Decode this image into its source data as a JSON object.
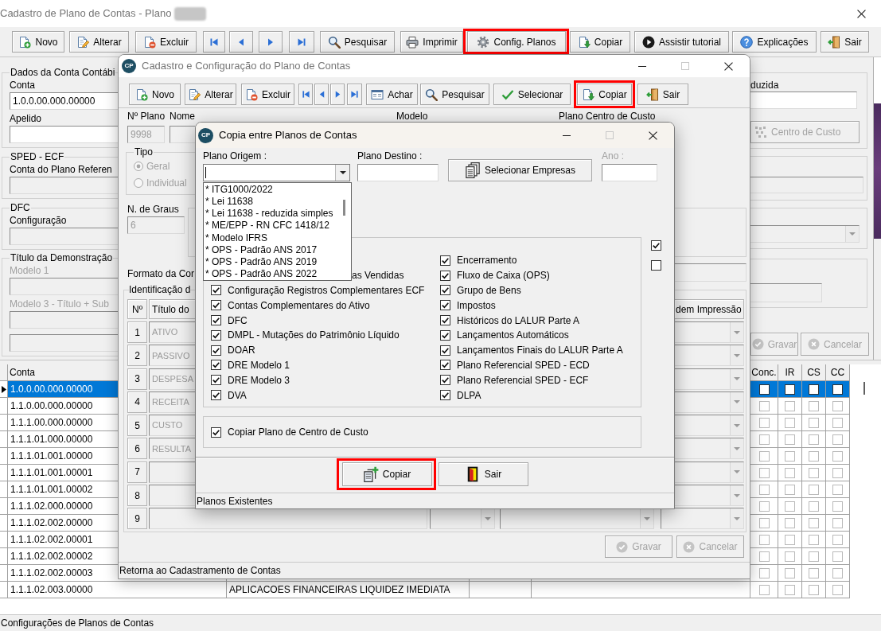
{
  "main_window": {
    "title": "Cadastro de Plano de Contas - Plano",
    "active": false,
    "controls": [
      {
        "kind": "close",
        "disabled": false
      }
    ],
    "toolbar": [
      {
        "kind": "new",
        "label": "Novo",
        "highlighted": false
      },
      {
        "kind": "edit",
        "label": "Alterar",
        "highlighted": false
      },
      {
        "kind": "delete",
        "label": "Excluir",
        "highlighted": false
      },
      {
        "kind": "first",
        "highlighted": false
      },
      {
        "kind": "prev",
        "highlighted": false
      },
      {
        "kind": "next",
        "highlighted": false
      },
      {
        "kind": "last",
        "highlighted": false
      },
      {
        "kind": "search",
        "label": "Pesquisar",
        "highlighted": false
      },
      {
        "kind": "print",
        "label": "Imprimir",
        "highlighted": false
      },
      {
        "kind": "settings",
        "label": "Config. Planos",
        "highlighted": true
      },
      {
        "kind": "copy",
        "label": "Copiar",
        "highlighted": false
      },
      {
        "kind": "tutorial",
        "label": "Assistir tutorial",
        "highlighted": false
      },
      {
        "kind": "help",
        "label": "Explicações",
        "highlighted": false
      },
      {
        "kind": "exit",
        "label": "Sair",
        "highlighted": false
      }
    ],
    "left_groups": [
      {
        "legend": "Dados da Conta Contábi",
        "fields": [
          {
            "label": "Conta",
            "value": "1.0.0.00.000.00000",
            "disabled": false,
            "readonly": false
          },
          {
            "label": "Apelido",
            "disabled": false,
            "readonly": false
          }
        ]
      },
      {
        "legend": "SPED - ECF",
        "fields": [
          {
            "label": "Conta do Plano Referen",
            "disabled": false,
            "readonly": true
          }
        ]
      },
      {
        "legend": "DFC",
        "fields": [
          {
            "label": "Configuração",
            "disabled": false,
            "readonly": true
          }
        ]
      },
      {
        "legend": "Título da Demonstração",
        "fields": [
          {
            "label": "Modelo 1",
            "disabled": true,
            "readonly": true
          },
          {
            "label": "Modelo 3 - Título + Sub",
            "disabled": true,
            "readonly": true
          },
          {
            "readonly": true
          }
        ]
      }
    ],
    "right_groups": [
      {
        "items": [
          {
            "kind": "field",
            "label": "duzida",
            "readonly": false
          },
          {
            "kind": "cost_center",
            "label": "Centro de Custo",
            "disabled": true
          }
        ]
      },
      {
        "items": [
          {
            "kind": "field",
            "readonly": true
          }
        ]
      },
      {
        "items": [
          {
            "kind": "dropdown",
            "readonly": true
          }
        ]
      },
      {
        "items": [
          {
            "kind": "field",
            "readonly": true
          }
        ]
      }
    ],
    "buttons": [
      {
        "kind": "save",
        "label": "Gravar",
        "disabled": true
      },
      {
        "kind": "cancel",
        "label": "Cancelar",
        "disabled": true
      }
    ],
    "table": {
      "columns": [
        "Conta",
        "Conc.",
        "IR",
        "CS",
        "CC"
      ],
      "rows": [
        {
          "conta": "1.0.0.00.000.00000",
          "selected": true,
          "conc": false,
          "ir": false,
          "cs": false,
          "cc": false
        },
        {
          "conta": "1.1.0.00.000.00000",
          "selected": false,
          "conc": false,
          "ir": false,
          "cs": false,
          "cc": false
        },
        {
          "conta": "1.1.1.00.000.00000",
          "selected": false,
          "conc": false,
          "ir": false,
          "cs": false,
          "cc": false
        },
        {
          "conta": "1.1.1.01.000.00000",
          "selected": false,
          "conc": false,
          "ir": false,
          "cs": false,
          "cc": false
        },
        {
          "conta": "1.1.1.01.001.00000",
          "selected": false,
          "conc": false,
          "ir": false,
          "cs": false,
          "cc": false
        },
        {
          "conta": "1.1.1.01.001.00001",
          "selected": false,
          "conc": false,
          "ir": false,
          "cs": false,
          "cc": false
        },
        {
          "conta": "1.1.1.01.001.00002",
          "selected": false,
          "conc": false,
          "ir": false,
          "cs": false,
          "cc": false
        },
        {
          "conta": "1.1.1.02.000.00000",
          "selected": false,
          "conc": false,
          "ir": false,
          "cs": false,
          "cc": false
        },
        {
          "conta": "1.1.1.02.002.00000",
          "selected": false,
          "conc": false,
          "ir": false,
          "cs": false,
          "cc": false
        },
        {
          "conta": "1.1.1.02.002.00001",
          "selected": false,
          "conc": false,
          "ir": false,
          "cs": false,
          "cc": false
        },
        {
          "conta": "1.1.1.02.002.00002",
          "selected": false,
          "conc": false,
          "ir": false,
          "cs": false,
          "cc": false
        },
        {
          "conta": "1.1.1.02.002.00003",
          "selected": false,
          "conc": false,
          "ir": false,
          "cs": false,
          "cc": false
        },
        {
          "conta": "1.1.1.02.003.00000",
          "description": "APLICACOES FINANCEIRAS LIQUIDEZ IMEDIATA",
          "selected": false,
          "conc": false,
          "ir": false,
          "cs": false,
          "cc": false
        }
      ]
    },
    "status_bar": "Configurações de Planos de Contas"
  },
  "config_window": {
    "logo": "CP",
    "title": "Cadastro e Configuração do Plano de Contas",
    "active": false,
    "controls": [
      {
        "kind": "minimize",
        "disabled": false
      },
      {
        "kind": "maximize",
        "disabled": true
      },
      {
        "kind": "close",
        "disabled": false
      }
    ],
    "toolbar": [
      {
        "kind": "new",
        "label": "Novo",
        "highlighted": false
      },
      {
        "kind": "edit",
        "label": "Alterar",
        "highlighted": false
      },
      {
        "kind": "delete",
        "label": "Excluir",
        "highlighted": false
      },
      {
        "kind": "first",
        "highlighted": false
      },
      {
        "kind": "prev",
        "highlighted": false
      },
      {
        "kind": "next",
        "highlighted": false
      },
      {
        "kind": "last",
        "highlighted": false
      },
      {
        "kind": "find",
        "label": "Achar",
        "highlighted": false
      },
      {
        "kind": "search",
        "label": "Pesquisar",
        "highlighted": false
      },
      {
        "kind": "select",
        "label": "Selecionar",
        "highlighted": false
      },
      {
        "kind": "copy",
        "label": "Copiar",
        "highlighted": true
      },
      {
        "kind": "exit",
        "label": "Sair",
        "highlighted": false
      }
    ],
    "labels": [
      "Nº Plano",
      "Nome",
      "Modelo",
      "Plano Centro de Custo"
    ],
    "plan_fields": [
      {
        "value": "9998",
        "disabled": true
      },
      {
        "disabled": true
      }
    ],
    "type_group": {
      "legend": "Tipo",
      "options": [
        {
          "label": "Geral",
          "selected": true,
          "disabled": true
        },
        {
          "label": "Individual",
          "selected": false,
          "disabled": true
        }
      ]
    },
    "degrees": {
      "label": "N. de Graus",
      "value": "6",
      "disabled": true
    },
    "format_label": "Formato da Cor",
    "format_field": {
      "readonly": true
    },
    "identification": {
      "legend": "Identificação d",
      "columns": [
        "Nº",
        "Título do",
        "dem Impressão"
      ],
      "rows": [
        {
          "number": "1",
          "title": "ATIVO"
        },
        {
          "number": "2",
          "title": "PASSIVO"
        },
        {
          "number": "3",
          "title": "DESPESA"
        },
        {
          "number": "4",
          "title": "RECEITA"
        },
        {
          "number": "5",
          "title": "CUSTO"
        },
        {
          "number": "6",
          "title": "RESULTA"
        },
        {
          "number": "7"
        },
        {
          "number": "8"
        },
        {
          "number": "9"
        }
      ]
    },
    "buttons": [
      {
        "kind": "save",
        "label": "Gravar",
        "disabled": true
      },
      {
        "kind": "cancel",
        "label": "Cancelar",
        "disabled": true
      }
    ],
    "status_bar": "Retorna ao Cadastramento de Contas"
  },
  "copy_dialog": {
    "logo": "CP",
    "title": "Copia entre Planos de Contas",
    "active": true,
    "controls": [
      {
        "kind": "minimize",
        "disabled": false
      },
      {
        "kind": "maximize",
        "disabled": true
      },
      {
        "kind": "close",
        "disabled": false
      }
    ],
    "origin": {
      "label": "Plano Origem :",
      "focused": true,
      "expanded": true,
      "options": [
        "* ITG1000/2022",
        "* Lei 11638",
        "* Lei 11638 - reduzida simples",
        "* ME/EPP - RN CFC 1418/12",
        "* Modelo IFRS",
        "* OPS - Padrão ANS 2017",
        "* OPS - Padrão ANS 2019",
        "* OPS - Padrão ANS 2022"
      ]
    },
    "destination": {
      "label": "Plano Destino :"
    },
    "select_companies": {
      "kind": "companies",
      "label": "Selecionar Empresas"
    },
    "year": {
      "label": "Ano :",
      "disabled": true
    },
    "options": {
      "left": [
        {
          "kind": "fragment",
          "label": "as Vendidas"
        },
        {
          "kind": "checkbox",
          "label": "Configuração Registros Complementares ECF",
          "checked": true
        },
        {
          "kind": "checkbox",
          "label": "Contas Complementares do Ativo",
          "checked": true
        },
        {
          "kind": "checkbox",
          "label": "DFC",
          "checked": true
        },
        {
          "kind": "checkbox",
          "label": "DMPL - Mutações do Patrimônio Líquido",
          "checked": true
        },
        {
          "kind": "checkbox",
          "label": "DOAR",
          "checked": true
        },
        {
          "kind": "checkbox",
          "label": "DRE Modelo 1",
          "checked": true
        },
        {
          "kind": "checkbox",
          "label": "DRE Modelo 3",
          "checked": true
        },
        {
          "kind": "checkbox",
          "label": "DVA",
          "checked": true
        }
      ],
      "right": [
        {
          "kind": "checkbox",
          "label": "Encerramento",
          "checked": true
        },
        {
          "kind": "checkbox",
          "label": "Fluxo de Caixa (OPS)",
          "checked": true
        },
        {
          "kind": "checkbox",
          "label": "Grupo de Bens",
          "checked": true
        },
        {
          "kind": "checkbox",
          "label": "Impostos",
          "checked": true
        },
        {
          "kind": "checkbox",
          "label": "Históricos do LALUR Parte A",
          "checked": true
        },
        {
          "kind": "checkbox",
          "label": "Lançamentos Automáticos",
          "checked": true
        },
        {
          "kind": "checkbox",
          "label": "Lançamentos Finais do LALUR Parte A",
          "checked": true
        },
        {
          "kind": "checkbox",
          "label": "Plano Referencial SPED - ECD",
          "checked": true
        },
        {
          "kind": "checkbox",
          "label": "Plano Referencial SPED - ECF",
          "checked": true
        },
        {
          "kind": "checkbox",
          "label": "DLPA",
          "checked": true
        }
      ]
    },
    "toggles": [
      {
        "checked": true
      },
      {
        "checked": false
      }
    ],
    "cost_center": {
      "label": "Copiar Plano de Centro de Custo",
      "checked": true
    },
    "buttons": [
      {
        "kind": "copy",
        "label": "Copiar",
        "highlighted": true
      },
      {
        "kind": "exit",
        "label": "Sair",
        "highlighted": false
      }
    ],
    "status_bar": "Planos Existentes"
  }
}
